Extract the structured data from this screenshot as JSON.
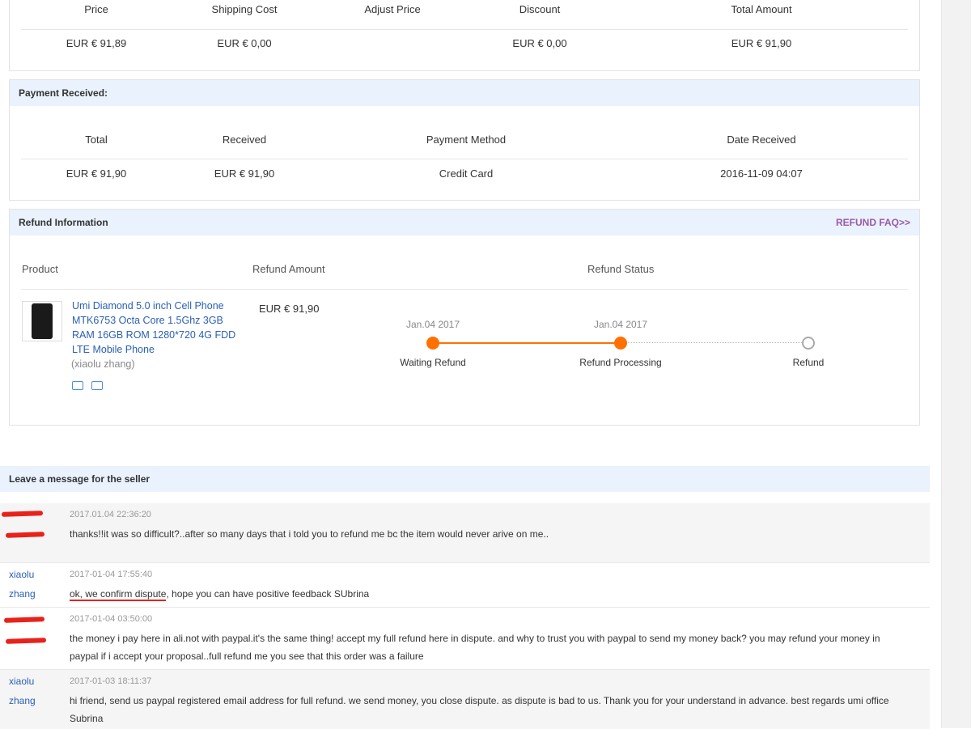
{
  "order_summary": {
    "headers": [
      "Price",
      "Shipping Cost",
      "Adjust Price",
      "Discount",
      "Total Amount"
    ],
    "values": [
      "EUR € 91,89",
      "EUR € 0,00",
      "",
      "EUR € 0,00",
      "EUR € 91,90"
    ]
  },
  "payment": {
    "title": "Payment Received:",
    "headers": [
      "Total",
      "Received",
      "Payment Method",
      "Date Received"
    ],
    "values": [
      "EUR € 91,90",
      "EUR € 91,90",
      "Credit Card",
      "2016-11-09 04:07"
    ]
  },
  "refund": {
    "title": "Refund Information",
    "faq_link": "REFUND FAQ>>",
    "headers": {
      "product": "Product",
      "amount": "Refund Amount",
      "status": "Refund Status"
    },
    "product_title": "Umi Diamond 5.0 inch Cell Phone MTK6753 Octa Core 1.5Ghz 3GB RAM 16GB ROM 1280*720 4G FDD LTE Mobile Phone",
    "seller": "(xiaolu zhang)",
    "amount": "EUR € 91,90",
    "steps": [
      {
        "date": "Jan.04 2017",
        "label": "Waiting Refund",
        "done": true
      },
      {
        "date": "Jan.04 2017",
        "label": "Refund Processing",
        "done": true
      },
      {
        "date": "",
        "label": "Refund",
        "done": false
      }
    ],
    "accent_color": "#ff7000"
  },
  "messages": {
    "title": "Leave a message for the seller",
    "items": [
      {
        "user_line1": "",
        "user_line2": "",
        "time": "2017.01.04 22:36:20",
        "text": "thanks!!it was so difficult?..after so many days that i told you to refund me bc the item would never arive on me.."
      },
      {
        "user_line1": "xiaolu",
        "user_line2": "zhang",
        "time": "2017-01-04 17:55:40",
        "text_underlined": "ok, we confirm dispute",
        "text": ", hope you can have positive feedback SUbrina"
      },
      {
        "user_line1": "",
        "user_line2": "",
        "time": "2017-01-04 03:50:00",
        "text": "the money i pay here in ali.not with paypal.it's the same thing! accept my full refund here in dispute. and why to trust you with paypal to send my money back? you may refund your money in paypal if i accept your proposal..full refund me you see that this order was a failure"
      },
      {
        "user_line1": "xiaolu",
        "user_line2": "zhang",
        "time": "2017-01-03 18:11:37",
        "text": "hi friend, send us paypal registered email address for full refund. we send money, you close dispute. as dispute is bad to us. Thank you for your understand in advance. best regards umi office Subrina"
      }
    ]
  }
}
